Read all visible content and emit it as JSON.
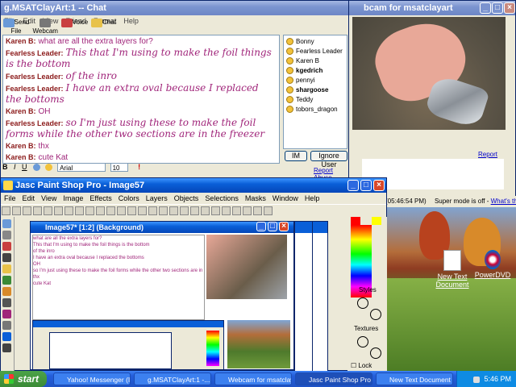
{
  "chat": {
    "title": "g.MSATClayArt:1 -- Chat",
    "menu": [
      "File",
      "Edit",
      "View",
      "Friend",
      "Format",
      "Help"
    ],
    "toolbar": [
      "Send File",
      "Webcam",
      "Voice",
      "Chat"
    ],
    "messages": [
      {
        "speaker": "Karen B:",
        "text": "what are all the extra layers for?",
        "style": "sans"
      },
      {
        "speaker": "Fearless Leader:",
        "text": "This that I'm using to make the foil things is the bottom",
        "style": "script"
      },
      {
        "speaker": "Fearless Leader:",
        "text": "of the inro",
        "style": "script"
      },
      {
        "speaker": "Fearless Leader:",
        "text": "I have an extra oval because I replaced the bottoms",
        "style": "script"
      },
      {
        "speaker": "Karen B:",
        "text": "OH",
        "style": "sans"
      },
      {
        "speaker": "Fearless Leader:",
        "text": "so I'm just using these to make the foil forms while the other two sections are in the freezer",
        "style": "script"
      },
      {
        "speaker": "Karen B:",
        "text": "thx",
        "style": "sans"
      },
      {
        "speaker": "Karen B:",
        "text": "cute Kat",
        "style": "sans"
      }
    ],
    "users": [
      "Bonny",
      "Fearless Leader",
      "Karen B",
      "kgedrich",
      "pennyi",
      "shargoose",
      "Teddy",
      "tobors_dragon"
    ],
    "im_button": "IM",
    "ignore_button": "Ignore User",
    "font_name": "Arial",
    "font_size": "10",
    "report_abuse": "Report Abuse",
    "bold": "B",
    "italic": "I",
    "underline": "U"
  },
  "webcam": {
    "title": "bcam for msatclayart",
    "report_abuse": "Report Abuse",
    "time": "(05:46:54 PM)",
    "super_mode": "Super mode is off -",
    "whats_this": "What's this?"
  },
  "psp": {
    "title": "Jasc Paint Shop Pro - Image57",
    "menu": [
      "File",
      "Edit",
      "View",
      "Image",
      "Effects",
      "Colors",
      "Layers",
      "Objects",
      "Selections",
      "Masks",
      "Window",
      "Help"
    ],
    "image_title": "Image57* [1:2] (Background)",
    "styles_label": "Styles",
    "textures_label": "Textures",
    "lock_label": "Lock"
  },
  "desktop": {
    "icons": [
      {
        "label": "New Text Document"
      },
      {
        "label": "PowerDVD"
      }
    ]
  },
  "taskbar": {
    "start": "start",
    "tasks": [
      "Yahoo! Messenger (I...",
      "g.MSATClayArt:1 -...",
      "Webcam for msatclay...",
      "Jasc Paint Shop Pro -...",
      "New Text Document ..."
    ],
    "clock": "5:46 PM"
  },
  "colors": {
    "title_active": "#0a5fd8",
    "chat_speaker": "#8b1a1a",
    "chat_text": "#a0257a",
    "taskbar": "#245edb"
  }
}
